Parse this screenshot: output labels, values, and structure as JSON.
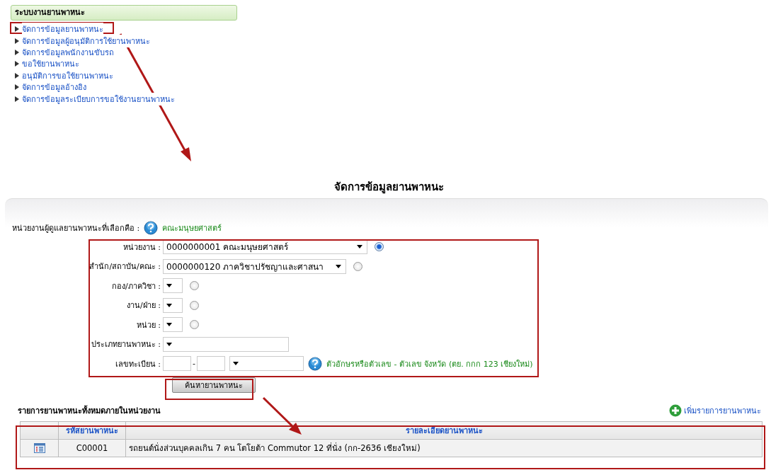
{
  "menu": {
    "title": "ระบบงานยานพาหนะ",
    "items": [
      "จัดการข้อมูลยานพาหนะ",
      "จัดการข้อมูลผู้อนุมัติการใช้ยานพาหนะ",
      "จัดการข้อมูลพนักงานขับรถ",
      "ขอใช้ยานพาหนะ",
      "อนุมัติการขอใช้ยานพาหนะ",
      "จัดการข้อมูลอ้างอิง",
      "จัดการข้อมูลระเบียบการขอใช้งานยานพาหนะ"
    ]
  },
  "page_title": "จัดการข้อมูลยานพาหนะ",
  "selected_unit": {
    "label": "หน่วยงานผู้ดูแลยานพาหนะที่เลือกคือ :",
    "value": "คณะมนุษยศาสตร์"
  },
  "filters": [
    {
      "kind": "unit",
      "label": "หน่วยงาน :",
      "value": "0000000001 คณะมนุษยศาสตร์",
      "selected": true
    },
    {
      "kind": "unit",
      "label": "สำนัก/สถาบัน/คณะ :",
      "value": "0000000120 ภาควิชาปรัชญาและศาสนา",
      "selected": false
    },
    {
      "kind": "unit",
      "label": "กอง/ภาควิชา :",
      "selected": false
    },
    {
      "kind": "unit",
      "label": "งาน/ฝ่าย :",
      "selected": false
    },
    {
      "kind": "unit",
      "label": "หน่วย :",
      "selected": false
    },
    {
      "kind": "select",
      "label": "ประเภทยานพาหนะ :"
    },
    {
      "kind": "plate",
      "label": "เลขทะเบียน :",
      "separator": "-",
      "hint": "ตัวอักษรหรือตัวเลข - ตัวเลข จังหวัด (ตย. กกก 123 เชียงใหม่)"
    }
  ],
  "search_button": "ค้นหายานพาหนะ",
  "list": {
    "title": "รายการยานพาหนะทั้งหมดภายในหน่วยงาน",
    "add_link": "เพิ่มรายการยานพาหนะ",
    "columns": [
      "รหัสยานพาหนะ",
      "รายละเอียดยานพาหนะ"
    ],
    "rows": [
      {
        "code": "C00001",
        "detail": "รถยนต์นั่งส่วนบุคคลเกิน 7 คน โตโยต้า Commutor 12 ที่นั่ง (กก-2636 เชียงใหม่)"
      }
    ]
  }
}
